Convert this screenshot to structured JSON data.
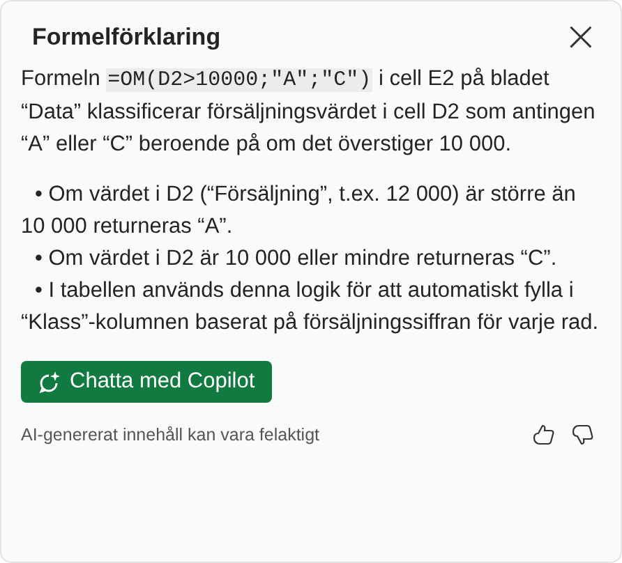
{
  "panel": {
    "title": "Formelförklaring",
    "close": "×"
  },
  "intro": {
    "before": "Formeln ",
    "code": "=OM(D2>10000;\"A\";\"C\")",
    "after": " i cell E2 på bladet “Data” klassificerar försäljningsvärdet i cell D2 som antingen “A” eller “C” beroende på om det överstiger 10 000."
  },
  "bullets": [
    "• Om värdet i D2 (“Försäljning”, t.ex. 12 000) är större än 10 000 returneras “A”.",
    "• Om värdet i D2 är 10 000 eller mindre returneras “C”.",
    "• I tabellen används denna logik för att automatiskt fylla i “Klass”-kolumnen baserat på försäljningssiffran för varje rad."
  ],
  "chat_button": {
    "label": "Chatta med Copilot"
  },
  "footer": {
    "disclaimer": "AI-genererat innehåll kan vara felaktigt"
  }
}
